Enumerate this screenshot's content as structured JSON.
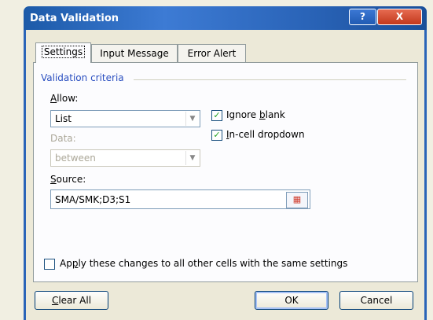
{
  "window": {
    "title": "Data Validation",
    "help_label": "?",
    "close_label": "X"
  },
  "tabs": [
    {
      "label": "Settings",
      "active": true
    },
    {
      "label": "Input Message",
      "active": false
    },
    {
      "label": "Error Alert",
      "active": false
    }
  ],
  "validation": {
    "group_title": "Validation criteria",
    "allow_label_u": "A",
    "allow_label_rest": "llow:",
    "allow_value": "List",
    "data_label": "Data:",
    "data_value": "between",
    "source_label_u": "S",
    "source_label_rest": "ource:",
    "source_value": "SMA/SMK;D3;S1",
    "ignore_blank_pre": "Ignore ",
    "ignore_blank_u": "b",
    "ignore_blank_post": "lank",
    "ignore_blank_checked": true,
    "incell_u": "I",
    "incell_rest": "n-cell dropdown",
    "incell_checked": true
  },
  "apply_all": {
    "pre": "Ap",
    "u": "p",
    "post": "ly these changes to all other cells with the same settings",
    "checked": false
  },
  "buttons": {
    "clear_u": "C",
    "clear_rest": "lear All",
    "ok": "OK",
    "cancel": "Cancel"
  },
  "colors": {
    "title_bar": "#2a64b8",
    "accent_label": "#2a4fc0",
    "check": "#21a121"
  }
}
